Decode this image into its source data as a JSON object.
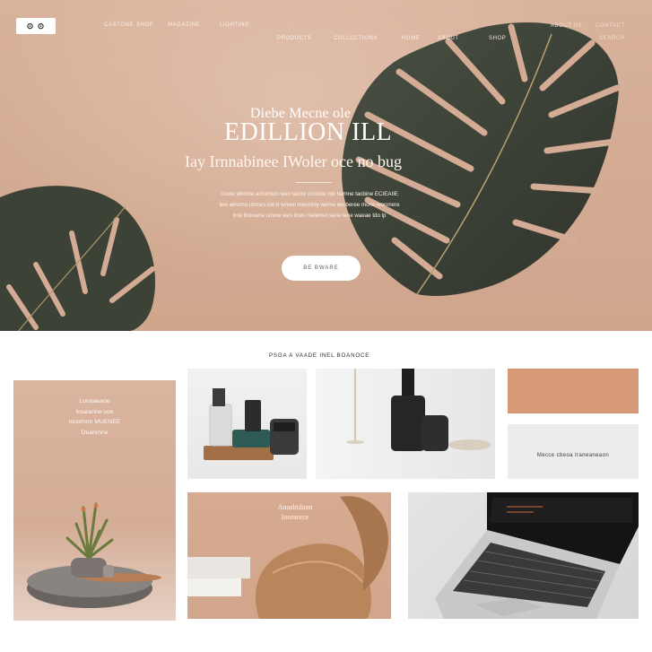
{
  "header": {
    "logo_text": "⊙ ⊙",
    "nav_left": [
      "CASTONE",
      "SHOP",
      "MAGAZINE",
      "LIGHTING"
    ],
    "nav_center": [
      "PRODUCTS",
      "COLLECTIONS"
    ],
    "nav_right_top": [
      "HOME",
      "ABOUT",
      "SHOP"
    ],
    "nav_right_far": [
      "ABOUT US",
      "CONTACT",
      "SEARCH"
    ]
  },
  "hero": {
    "line1": "Diebe Mecne ole",
    "line2": "EDILLION ILL",
    "subtitle": "Iay Irnnabinee IWoler oce no bug",
    "paragraph": [
      "Uowe whome amonhon wen lamre ommoe nte hamne laobine ECIEAIIE",
      "Iwe whorno umnes loe b wreen meoreny weme we beree mone wonmere",
      "Irne lbowane umow wes lows melemel sene lene waeae tdo lp"
    ],
    "cta_label": "BE BWARE"
  },
  "products": {
    "section_title": "PSGA A VAADE INEL BOANOCE",
    "card1_lines": [
      "Lonaaeane",
      "Iroaranne ooo",
      "Ionornnn MUENEE",
      "Ouanrnne"
    ],
    "card4_label": "Mecce cbeoa Iraneaneaon",
    "card5_lines": [
      "Anaabidann",
      "Iooraorce"
    ]
  },
  "colors": {
    "hero_bg": "#d6ae96",
    "leaf": "#3f4438",
    "card_tan": "#d6ab91",
    "accent_orange": "#d69a77"
  }
}
